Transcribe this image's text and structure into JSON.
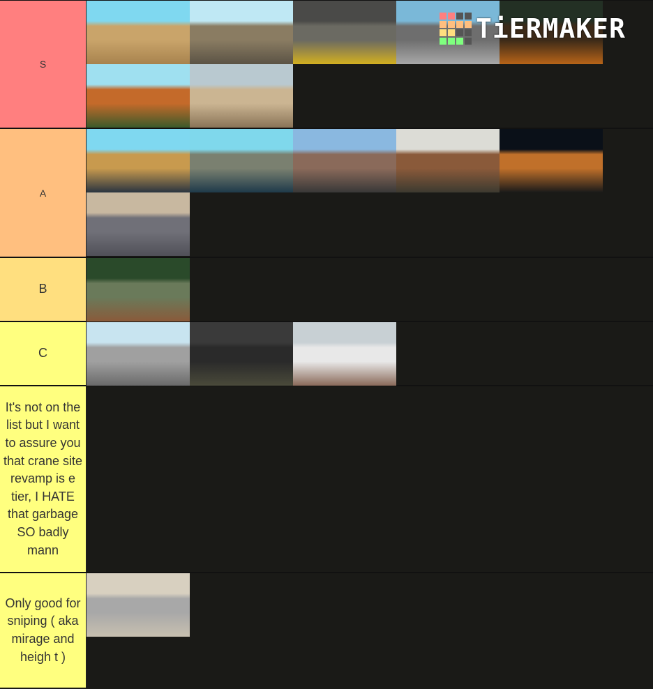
{
  "watermark": {
    "text": "TiERMAKER",
    "grid_colors": [
      "#ff7f7f",
      "#ff7f7f",
      "#555555",
      "#555555",
      "#ffbf7f",
      "#ffbf7f",
      "#ffbf7f",
      "#ffbf7f",
      "#ffdf7f",
      "#ffdf7f",
      "#555555",
      "#555555",
      "#7fff7f",
      "#7fff7f",
      "#7fff7f",
      "#555555"
    ]
  },
  "tiers": [
    {
      "label": "S",
      "color": "#ff7f7f",
      "size": "small",
      "items": [
        {
          "name": "desert-town-map",
          "scene": [
            "#7fd8f0",
            "#c9a46a",
            "#a8834e"
          ]
        },
        {
          "name": "crane-site-map",
          "scene": [
            "#bfe8f4",
            "#8a7c62",
            "#5b5345"
          ]
        },
        {
          "name": "subway-station-map",
          "scene": [
            "#4a4a48",
            "#6b6a62",
            "#d4b020"
          ]
        },
        {
          "name": "industrial-gas-station-map",
          "scene": [
            "#7ab8d8",
            "#6e6e6e",
            "#a8a8a8"
          ]
        },
        {
          "name": "night-gas-station-map",
          "scene": [
            "#233024",
            "#3c2a18",
            "#b86418"
          ]
        },
        {
          "name": "suburb-pool-map",
          "scene": [
            "#9fe0f0",
            "#c46a2a",
            "#3c5a2a"
          ]
        },
        {
          "name": "desert-market-map",
          "scene": [
            "#b9c9d0",
            "#cbb592",
            "#8a7458"
          ]
        }
      ]
    },
    {
      "label": "A",
      "color": "#ffbf7f",
      "size": "small",
      "items": [
        {
          "name": "motel-highway-map",
          "scene": [
            "#7fd8f0",
            "#c89a4e",
            "#2a3440"
          ]
        },
        {
          "name": "power-plant-map",
          "scene": [
            "#7fd8ec",
            "#7a8070",
            "#1e3a4a"
          ]
        },
        {
          "name": "city-street-map",
          "scene": [
            "#8ab8e0",
            "#8a6a5a",
            "#383838"
          ]
        },
        {
          "name": "church-map",
          "scene": [
            "#dcdcd6",
            "#8a5a3a",
            "#3c3a30"
          ]
        },
        {
          "name": "oil-rig-map",
          "scene": [
            "#0a1018",
            "#c0702a",
            "#1a1a1a"
          ]
        },
        {
          "name": "refinery-map",
          "scene": [
            "#c8b8a0",
            "#707078",
            "#505058"
          ]
        }
      ]
    },
    {
      "label": "B",
      "color": "#ffdf7f",
      "size": "big",
      "items": [
        {
          "name": "jungle-village-map",
          "scene": [
            "#2a4a2a",
            "#6a7a5a",
            "#8a5a3a"
          ]
        }
      ]
    },
    {
      "label": "C",
      "color": "#ffff7f",
      "size": "big",
      "items": [
        {
          "name": "construction-yard-map",
          "scene": [
            "#c8e4f0",
            "#a0a0a0",
            "#6a6a6a"
          ]
        },
        {
          "name": "bunker-map",
          "scene": [
            "#3a3a3a",
            "#2a2a2a",
            "#4a4a3a"
          ]
        },
        {
          "name": "snow-base-map",
          "scene": [
            "#c8d0d4",
            "#e8e8e8",
            "#8a6a5a"
          ]
        }
      ]
    },
    {
      "label": "It's not on the list but I want to assure you that crane site revamp is e tier, I HATE that garbage SO badly mann",
      "color": "#ffff7f",
      "size": "big",
      "items": []
    },
    {
      "label": "Only good for sniping ( aka mirage and heigh t )",
      "color": "#ffff7f",
      "size": "big",
      "items": [
        {
          "name": "aerial-city-map",
          "scene": [
            "#d8d0c0",
            "#a8a8a8",
            "#c8c0b0"
          ]
        }
      ]
    }
  ]
}
